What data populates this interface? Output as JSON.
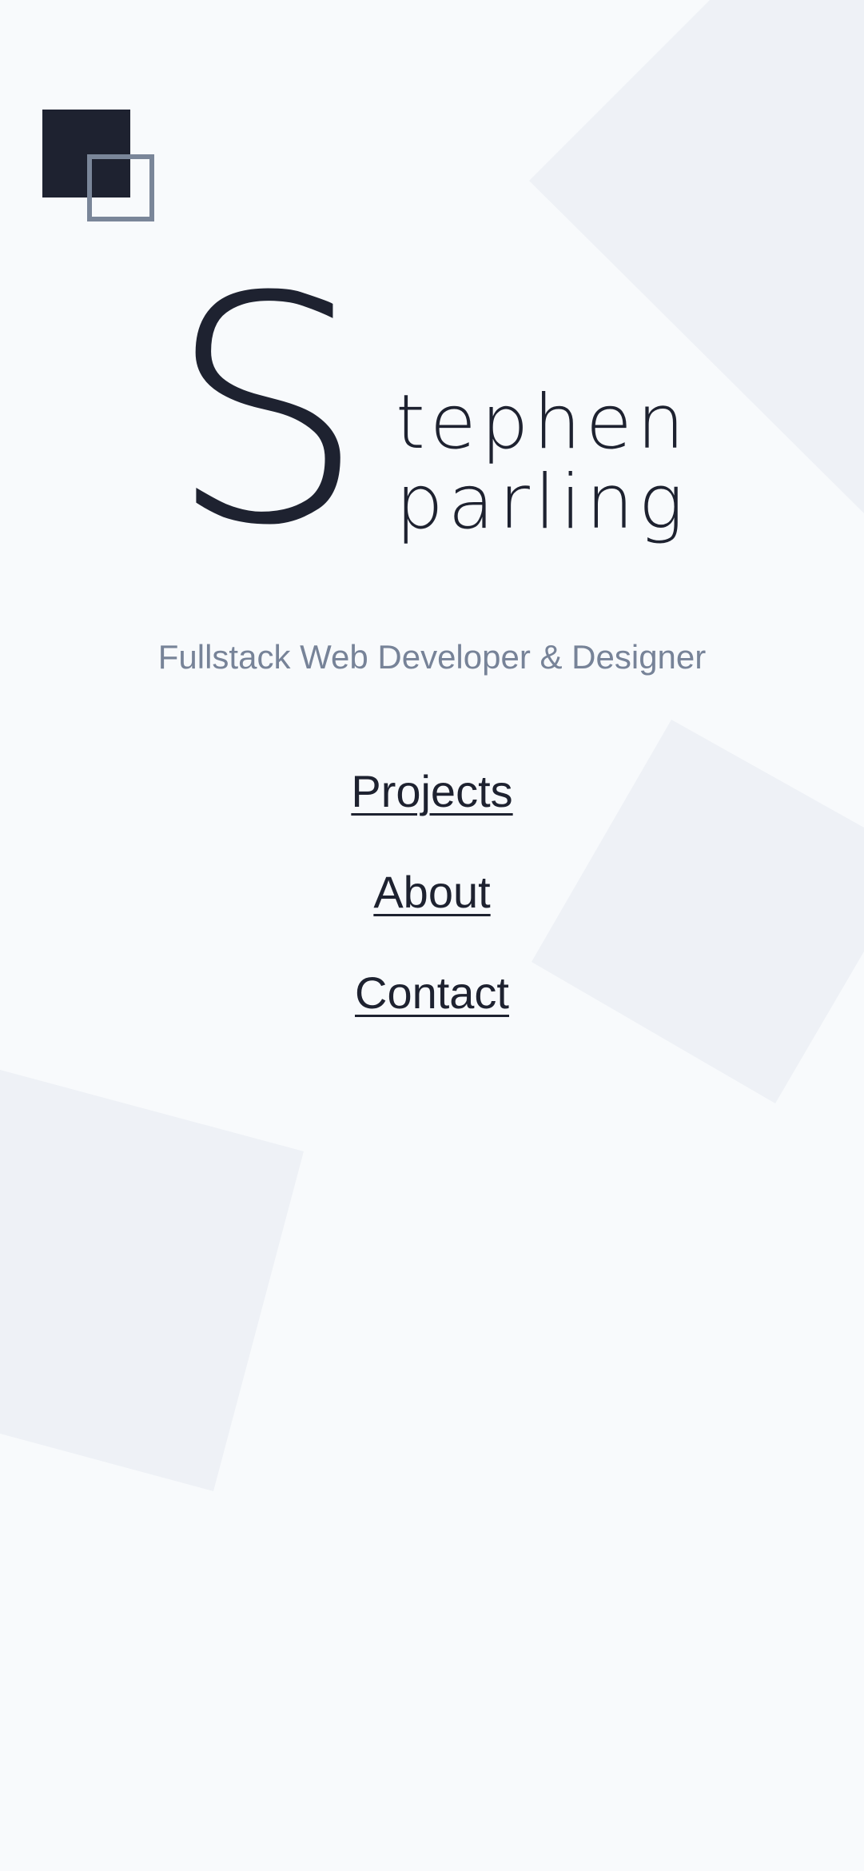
{
  "theme": {
    "background": "#f8fafc",
    "shape": "#eef1f6",
    "dark": "#1e2230",
    "muted": "#778398"
  },
  "logo": {
    "icon": "overlapping-squares-logo-icon"
  },
  "hero": {
    "initial": "S",
    "line1": "tephen",
    "line2": "parling",
    "tagline": "Fullstack Web Developer & Designer"
  },
  "nav": {
    "projects": "Projects",
    "about": "About",
    "contact": "Contact"
  }
}
